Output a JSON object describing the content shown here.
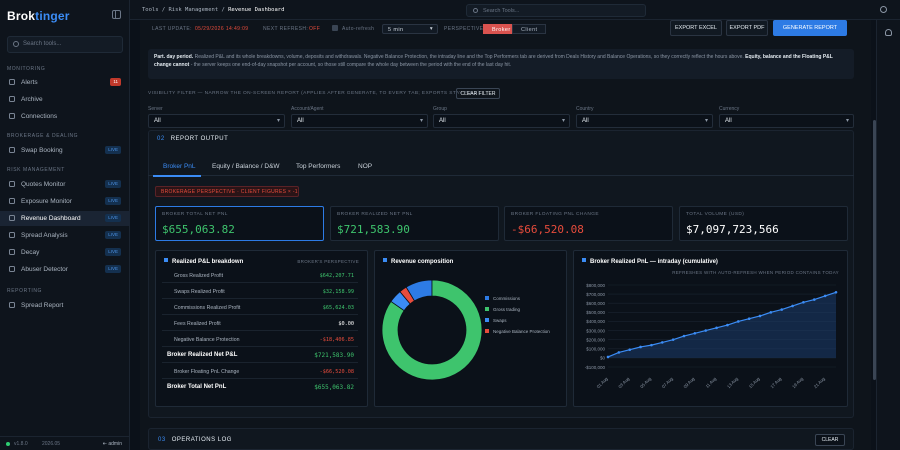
{
  "app": {
    "logo_prefix": "Brok",
    "logo_suffix": "tinger"
  },
  "sidebar": {
    "search_placeholder": "Search tools...",
    "sections": {
      "monitoring": "MONITORING",
      "brokerage": "BROKERAGE & DEALING",
      "risk": "RISK MANAGEMENT",
      "reporting": "REPORTING"
    },
    "items": [
      {
        "label": "Alerts",
        "badge": "11",
        "badge_color": "red"
      },
      {
        "label": "Archive"
      },
      {
        "label": "Connections"
      },
      {
        "label": "Swap Booking",
        "badge": "LIVE"
      },
      {
        "label": "Quotes Monitor",
        "badge": "LIVE"
      },
      {
        "label": "Exposure Monitor",
        "badge": "LIVE"
      },
      {
        "label": "Revenue Dashboard",
        "badge": "LIVE",
        "active": true
      },
      {
        "label": "Spread Analysis",
        "badge": "LIVE"
      },
      {
        "label": "Decay",
        "badge": "LIVE"
      },
      {
        "label": "Abuser Detector",
        "badge": "LIVE"
      },
      {
        "label": "Spread Report"
      }
    ],
    "footer": {
      "version": "v1.8.0",
      "year": "2026.05",
      "user": "admin"
    }
  },
  "topbar": {
    "crumbs": [
      "Tools",
      "Risk Management",
      "Revenue Dashboard"
    ],
    "search_placeholder": "Search Tools..."
  },
  "controls": {
    "last_update_label": "LAST UPDATE:",
    "last_update_value": "05/29/2026 14:49:09",
    "next_refresh_label": "NEXT REFRESH:",
    "next_refresh_value": "OFF",
    "auto_refresh_label": "Auto-refresh",
    "interval": "5 min",
    "perspective_label": "PERSPECTIVE",
    "perspective_options": [
      "Broker",
      "Client"
    ],
    "buttons": {
      "export_excel": "EXPORT EXCEL",
      "export_pdf": "EXPORT PDF",
      "generate": "GENERATE REPORT"
    }
  },
  "notice": {
    "lead": "Part. day period.",
    "text": "Realized P&L and its whole breakdowns, volume, deposits and withdrawals. Negative Balance Protection, the intraday line and the Top Performers tab are derived from Deals History and Balance Operations, so they correctly reflect the hours above.",
    "bold": "Equity, balance and the Floating P&L change cannot",
    "tail": "- the server keeps one end-of-day snapshot per account, so those still compare the whole day between the period with the end of the last day hit."
  },
  "visibility": {
    "label": "VISIBILITY FILTER — NARROW THE ON-SCREEN REPORT (APPLIES AFTER GENERATE, TO EVERY TAB; EXPORTS STAY FULL)",
    "clear": "CLEAR FILTER"
  },
  "filters": [
    {
      "label": "Server",
      "value": "All"
    },
    {
      "label": "Account/Agent",
      "value": "All"
    },
    {
      "label": "Group",
      "value": "All"
    },
    {
      "label": "Country",
      "value": "All"
    },
    {
      "label": "Currency",
      "value": "All"
    }
  ],
  "report": {
    "number": "02",
    "title": "REPORT OUTPUT",
    "tabs": [
      "Broker PnL",
      "Equity / Balance / D&W",
      "Top Performers",
      "NOP"
    ],
    "perspective_badge": "BROKERAGE PERSPECTIVE · CLIENT FIGURES × -1",
    "kpis": [
      {
        "label": "BROKER TOTAL NET PNL",
        "value": "$655,063.82",
        "color": "#3ec46d"
      },
      {
        "label": "BROKER REALIZED NET PNL",
        "value": "$721,583.90",
        "color": "#3ec46d"
      },
      {
        "label": "BROKER FLOATING PNL CHANGE",
        "value": "-$66,520.08",
        "color": "#e74c3c"
      },
      {
        "label": "TOTAL VOLUME (USD)",
        "value": "$7,097,723,566",
        "color": "#ffffff"
      }
    ],
    "breakdown": {
      "title": "Realized P&L breakdown",
      "subtitle": "BROKER'S PERSPECTIVE",
      "rows": [
        {
          "label": "Gross Realized Profit",
          "value": "$642,207.71",
          "color": "g"
        },
        {
          "label": "Swaps Realized Profit",
          "value": "$32,158.99",
          "color": "g"
        },
        {
          "label": "Commissions Realized Profit",
          "value": "$65,624.03",
          "color": "g"
        },
        {
          "label": "Fees Realized Profit",
          "value": "$0.00",
          "color": "w"
        },
        {
          "label": "Negative Balance Protection",
          "value": "-$18,406.85",
          "color": "r"
        },
        {
          "label": "Broker Realized Net P&L",
          "value": "$721,583.90",
          "color": "g",
          "bold": true
        },
        {
          "label": "Broker Floating PnL Change",
          "value": "-$66,520.08",
          "color": "r"
        },
        {
          "label": "Broker Total Net PnL",
          "value": "$655,063.82",
          "color": "g",
          "bold": true
        }
      ]
    },
    "composition": {
      "title": "Revenue composition",
      "legend": [
        {
          "label": "Commissions",
          "color": "#2d7be5"
        },
        {
          "label": "Gross trading",
          "color": "#3ec46d"
        },
        {
          "label": "Swaps",
          "color": "#3b8cf5"
        },
        {
          "label": "Negative Balance Protection",
          "color": "#e74c3c"
        }
      ]
    },
    "intraday": {
      "title": "Broker Realized PnL — intraday (cumulative)",
      "subtitle": "REFRESHES WITH AUTO-REFRESH WHEN PERIOD CONTAINS TODAY"
    }
  },
  "chart_data": [
    {
      "type": "pie",
      "title": "Revenue composition",
      "labels": [
        "Commissions",
        "Gross trading",
        "Swaps",
        "Negative Balance Protection"
      ],
      "values": [
        65624.03,
        642207.71,
        32158.99,
        18406.85
      ]
    },
    {
      "type": "line",
      "title": "Broker Realized PnL — intraday (cumulative)",
      "x": [
        "01 Aug",
        "02 Aug",
        "03 Aug",
        "04 Aug",
        "05 Aug",
        "06 Aug",
        "07 Aug",
        "08 Aug",
        "09 Aug",
        "10 Aug",
        "11 Aug",
        "12 Aug",
        "13 Aug",
        "14 Aug",
        "15 Aug",
        "16 Aug",
        "17 Aug",
        "18 Aug",
        "19 Aug",
        "20 Aug",
        "21 Aug",
        "22 Aug"
      ],
      "y": [
        10000,
        60000,
        90000,
        120000,
        140000,
        170000,
        200000,
        240000,
        270000,
        300000,
        330000,
        360000,
        400000,
        430000,
        460000,
        500000,
        530000,
        570000,
        610000,
        640000,
        680000,
        720000
      ],
      "ylim": [
        -100000,
        800000
      ],
      "yticks": [
        "$800,000",
        "$700,000",
        "$600,000",
        "$500,000",
        "$400,000",
        "$300,000",
        "$200,000",
        "$100,000",
        "$0",
        "-$100,000"
      ]
    }
  ],
  "oplog": {
    "number": "03",
    "title": "OPERATIONS LOG",
    "clear": "CLEAR"
  }
}
